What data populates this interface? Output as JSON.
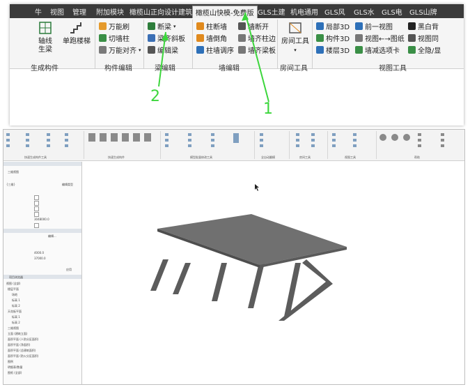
{
  "top_ribbon": {
    "tabs": [
      {
        "label": "牛"
      },
      {
        "label": "视图"
      },
      {
        "label": "管理"
      },
      {
        "label": "附加模块"
      },
      {
        "label": "橄榄山正向设计建筑"
      },
      {
        "label": "橄榄山快模-免费版"
      },
      {
        "label": "GLS土建"
      },
      {
        "label": "机电通用"
      },
      {
        "label": "GLS风"
      },
      {
        "label": "GLS水"
      },
      {
        "label": "GLS电"
      },
      {
        "label": "GLS山牌"
      }
    ],
    "buttons": {
      "axis_gen": "轴线\n生梁",
      "single_stair": "单跑楼梯",
      "universal_brush": "万能刷",
      "cut_column": "切墙柱",
      "universal_align": "万能对齐",
      "break_beam": "断梁",
      "beam_slope": "梁齐斜板",
      "merge_beam": "编辑梁",
      "column_break_wall": "柱断墙",
      "wall_fillet": "墙倒角",
      "column_wall_adjust": "柱墙调序",
      "wall_break_open": "墙断开",
      "wall_align_column": "墙齐柱边",
      "wall_align_beam": "墙齐梁板",
      "room_tools": "房间工具",
      "local_3d": "局部3D",
      "component_3d": "构件3D",
      "floor_3d": "楼层3D",
      "front_view": "前一视图",
      "view_drawing": "视图←→图纸",
      "wall_reduce": "墙减选项卡",
      "black_white_bg": "黑白背",
      "view_same": "视图同",
      "show_hide": "全隐/显"
    },
    "groups": {
      "gen_components": "生成构件",
      "component_edit": "构件编辑",
      "beam_edit": "梁编辑",
      "wall_edit": "墙编辑",
      "room_tools": "房间工具",
      "view_tools": "视图工具"
    },
    "annotations": {
      "label_1": "1",
      "label_2": "2"
    }
  },
  "bottom_window": {
    "mini_ribbon_groups": [
      "快速生成构件工具",
      "快速生成构件",
      "模型批量修改工具",
      "全自动翻模",
      "房间工具",
      "视图工具",
      "帮助"
    ],
    "left_panel": {
      "view_type": "三维视图",
      "type_selector": "{三维}",
      "edit_type_button": "编辑类型",
      "edit_button": "编辑...",
      "value_1": "3048000.0",
      "value_2": "4000.0",
      "value_3": "37000.0",
      "apply_button": "应用",
      "browser_title": "项目浏览器",
      "tree_items": [
        "视图 (全部)",
        "楼层平面",
        "场地",
        "标高 1",
        "标高 2",
        "天花板平面",
        "标高 1",
        "标高 2",
        "三维视图",
        "立面 (建筑立面)",
        "面积平面 (人防分区面积)",
        "面积平面 (净面积)",
        "面积平面 (总建筑面积)",
        "面积平面 (防火分区面积)",
        "图例",
        "明细表/数量",
        "图纸 (全部)"
      ]
    }
  },
  "colors": {
    "arrow_green": "#3cd63c",
    "slab_gray": "#6f6f6f",
    "tab_bar_dark": "#3b3b3b"
  }
}
